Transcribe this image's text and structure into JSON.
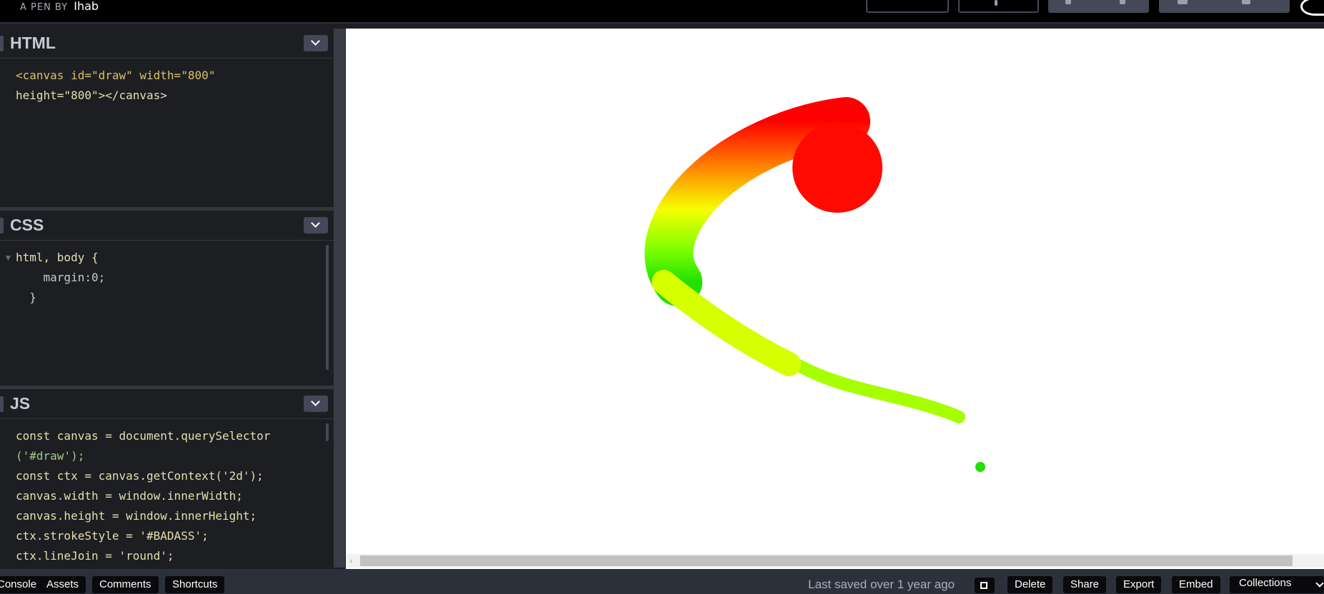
{
  "topbar": {
    "pen_by_prefix": "A PEN BY",
    "author": "Ihab"
  },
  "editors": {
    "html": {
      "title": "HTML",
      "code_lines": [
        "<canvas id=\"draw\" width=\"800\"",
        "height=\"800\"></canvas>"
      ]
    },
    "css": {
      "title": "CSS",
      "code_lines": [
        "html, body {",
        "    margin:0;",
        "  }"
      ]
    },
    "js": {
      "title": "JS",
      "code_lines": [
        "const canvas = document.querySelector",
        "('#draw');",
        "const ctx = canvas.getContext('2d');",
        "canvas.width = window.innerWidth;",
        "canvas.height = window.innerHeight;",
        "ctx.strokeStyle = '#BADASS';",
        "ctx.lineJoin = 'round';"
      ]
    }
  },
  "preview": {
    "stroke_gradient_colors": [
      "#ff0000",
      "#ff8c00",
      "#f5ff00",
      "#7dff00",
      "#22e000"
    ],
    "background": "#ffffff"
  },
  "bottombar": {
    "console": "Console",
    "assets": "Assets",
    "comments": "Comments",
    "shortcuts": "Shortcuts",
    "last_saved": "Last saved over 1 year ago",
    "delete": "Delete",
    "share": "Share",
    "export": "Export",
    "embed": "Embed",
    "collections": "Collections"
  },
  "icons": [
    "chevron-down-icon",
    "external-link-icon",
    "scroll-left-icon",
    "avatar-icon"
  ]
}
